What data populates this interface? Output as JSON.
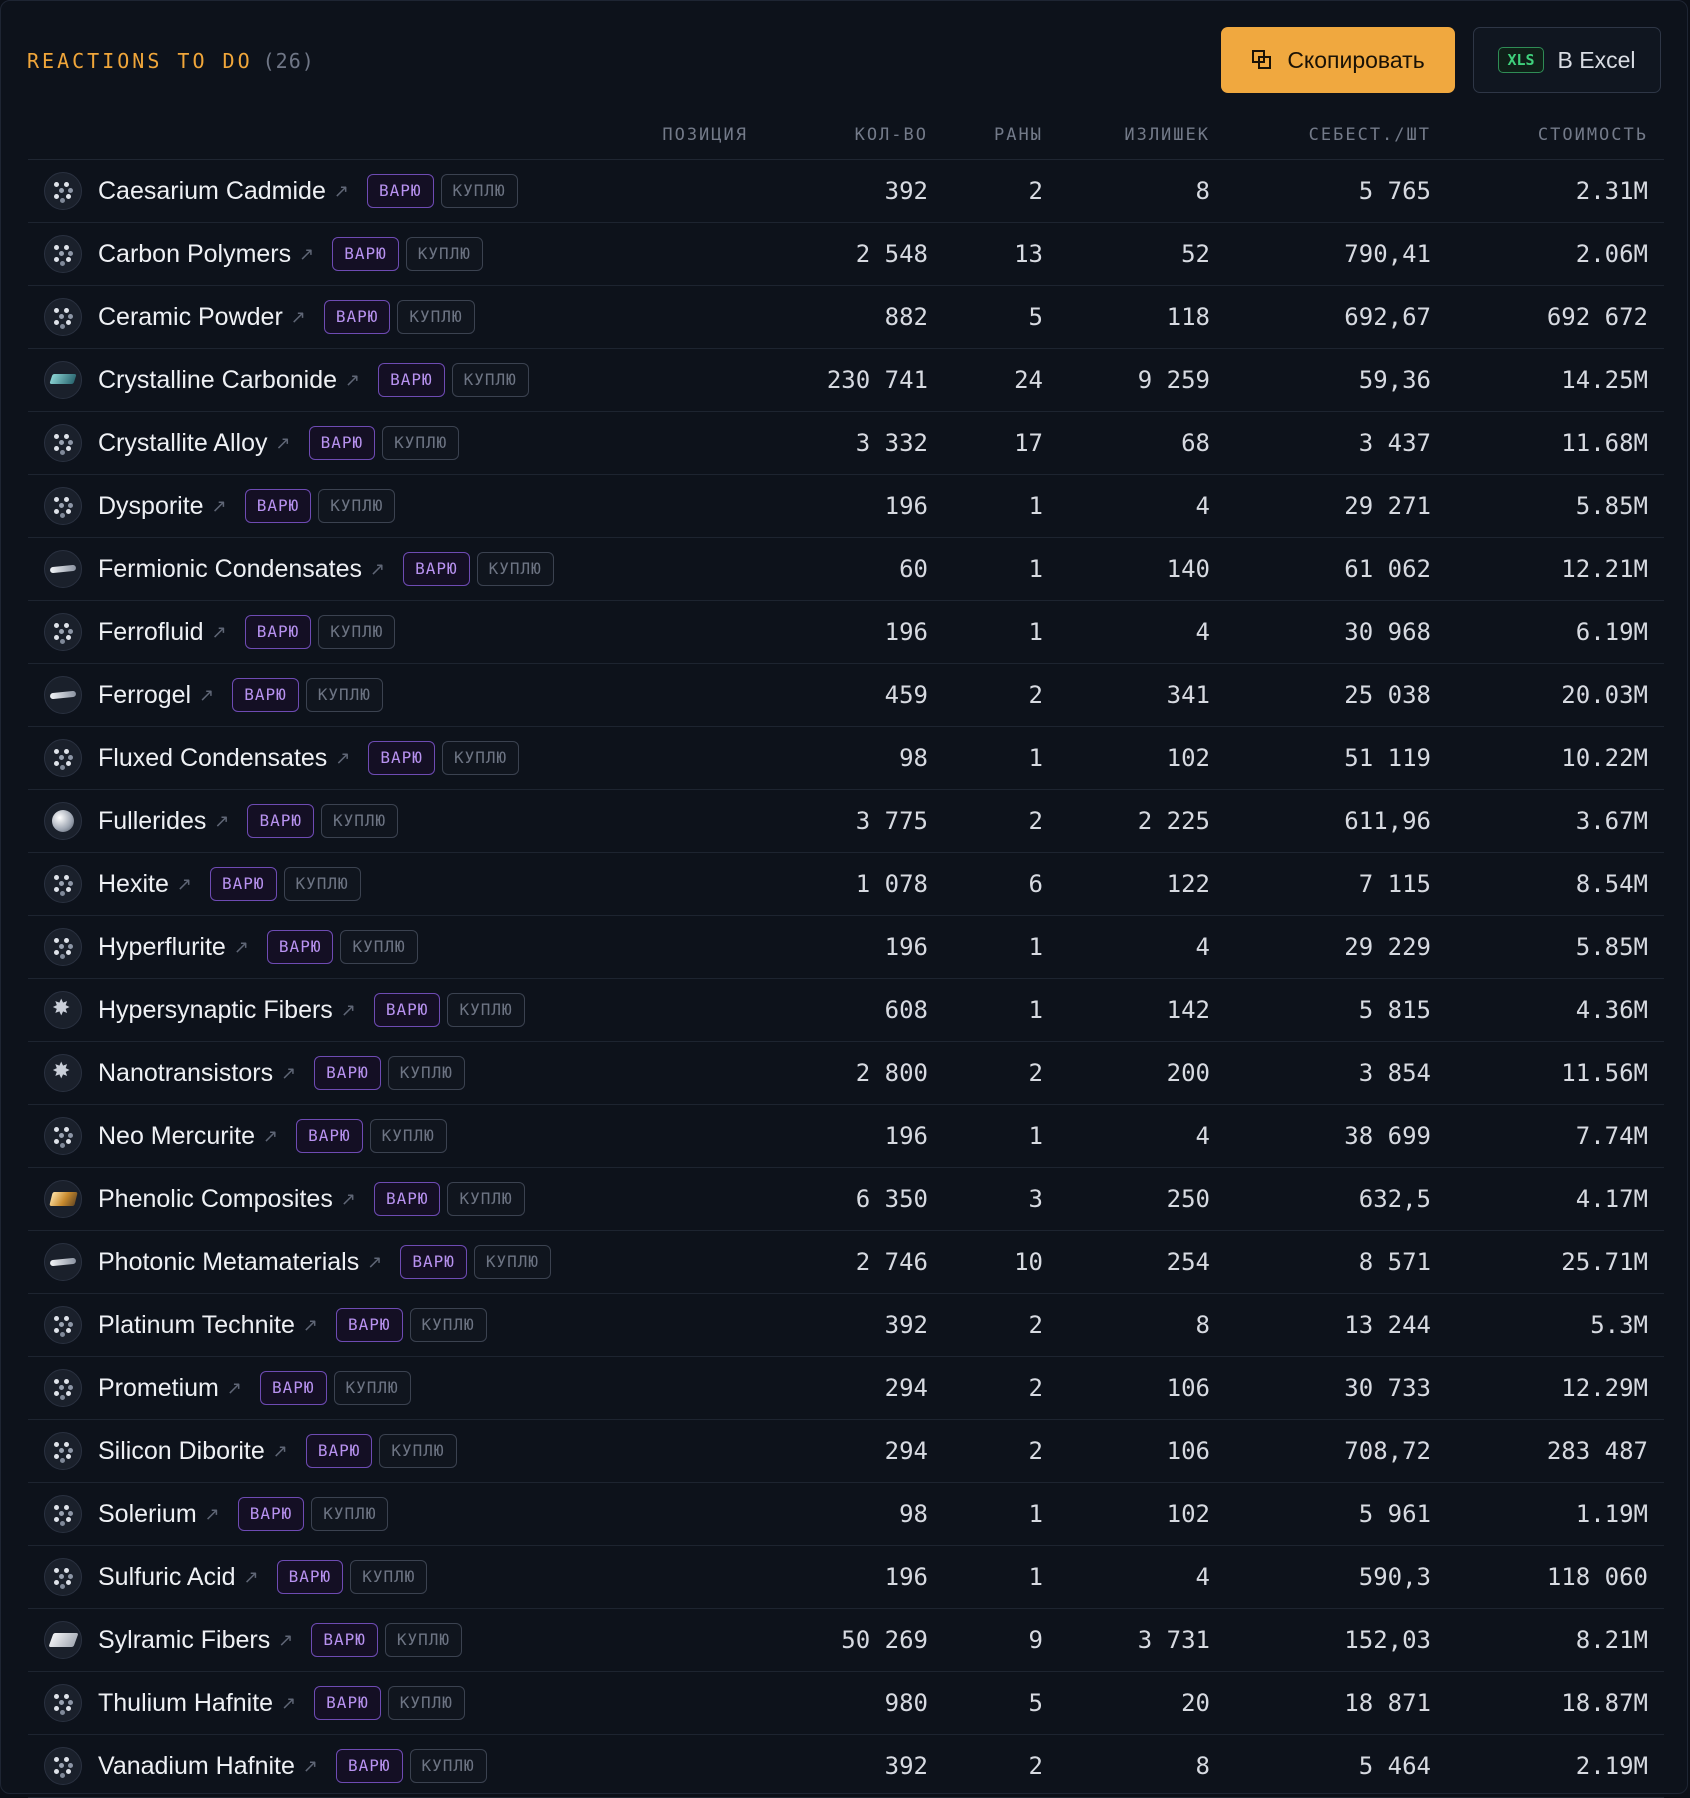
{
  "header": {
    "title": "REACTIONS TO DO",
    "count": "(26)",
    "copy_button": "Скопировать",
    "excel_badge": "XLS",
    "excel_button": "В Excel"
  },
  "columns": {
    "position": "ПОЗИЦИЯ",
    "qty": "КОЛ-ВО",
    "runs": "РАНЫ",
    "surplus": "ИЗЛИШЕК",
    "unit_cost": "СЕБЕСТ./ШТ",
    "cost": "СТОИМОСТЬ"
  },
  "tags": {
    "brew": "ВАРЮ",
    "buy": "КУПЛЮ"
  },
  "rows": [
    {
      "name": "Caesarium Cadmide",
      "icon": "molecule-icon",
      "qty": "392",
      "runs": "2",
      "surplus": "8",
      "unit_cost": "5 765",
      "cost": "2.31M"
    },
    {
      "name": "Carbon Polymers",
      "icon": "molecule-icon",
      "qty": "2 548",
      "runs": "13",
      "surplus": "52",
      "unit_cost": "790,41",
      "cost": "2.06M"
    },
    {
      "name": "Ceramic Powder",
      "icon": "molecule-icon",
      "qty": "882",
      "runs": "5",
      "surplus": "118",
      "unit_cost": "692,67",
      "cost": "692 672"
    },
    {
      "name": "Crystalline Carbonide",
      "icon": "crystal-plate-icon",
      "qty": "230 741",
      "runs": "24",
      "surplus": "9 259",
      "unit_cost": "59,36",
      "cost": "14.25M"
    },
    {
      "name": "Crystallite Alloy",
      "icon": "molecule-icon",
      "qty": "3 332",
      "runs": "17",
      "surplus": "68",
      "unit_cost": "3 437",
      "cost": "11.68M"
    },
    {
      "name": "Dysporite",
      "icon": "molecule-icon",
      "qty": "196",
      "runs": "1",
      "surplus": "4",
      "unit_cost": "29 271",
      "cost": "5.85M"
    },
    {
      "name": "Fermionic Condensates",
      "icon": "wing-icon",
      "qty": "60",
      "runs": "1",
      "surplus": "140",
      "unit_cost": "61 062",
      "cost": "12.21M"
    },
    {
      "name": "Ferrofluid",
      "icon": "molecule-icon",
      "qty": "196",
      "runs": "1",
      "surplus": "4",
      "unit_cost": "30 968",
      "cost": "6.19M"
    },
    {
      "name": "Ferrogel",
      "icon": "wing-icon",
      "qty": "459",
      "runs": "2",
      "surplus": "341",
      "unit_cost": "25 038",
      "cost": "20.03M"
    },
    {
      "name": "Fluxed Condensates",
      "icon": "molecule-icon",
      "qty": "98",
      "runs": "1",
      "surplus": "102",
      "unit_cost": "51 119",
      "cost": "10.22M"
    },
    {
      "name": "Fullerides",
      "icon": "sphere-icon",
      "qty": "3 775",
      "runs": "2",
      "surplus": "2 225",
      "unit_cost": "611,96",
      "cost": "3.67M"
    },
    {
      "name": "Hexite",
      "icon": "molecule-icon",
      "qty": "1 078",
      "runs": "6",
      "surplus": "122",
      "unit_cost": "7 115",
      "cost": "8.54M"
    },
    {
      "name": "Hyperflurite",
      "icon": "molecule-icon",
      "qty": "196",
      "runs": "1",
      "surplus": "4",
      "unit_cost": "29 229",
      "cost": "5.85M"
    },
    {
      "name": "Hypersynaptic Fibers",
      "icon": "fiber-icon",
      "qty": "608",
      "runs": "1",
      "surplus": "142",
      "unit_cost": "5 815",
      "cost": "4.36M"
    },
    {
      "name": "Nanotransistors",
      "icon": "fiber-icon",
      "qty": "2 800",
      "runs": "2",
      "surplus": "200",
      "unit_cost": "3 854",
      "cost": "11.56M"
    },
    {
      "name": "Neo Mercurite",
      "icon": "molecule-icon",
      "qty": "196",
      "runs": "1",
      "surplus": "4",
      "unit_cost": "38 699",
      "cost": "7.74M"
    },
    {
      "name": "Phenolic Composites",
      "icon": "composite-slab-icon",
      "qty": "6 350",
      "runs": "3",
      "surplus": "250",
      "unit_cost": "632,5",
      "cost": "4.17M"
    },
    {
      "name": "Photonic Metamaterials",
      "icon": "wing-icon",
      "qty": "2 746",
      "runs": "10",
      "surplus": "254",
      "unit_cost": "8 571",
      "cost": "25.71M"
    },
    {
      "name": "Platinum Technite",
      "icon": "molecule-icon",
      "qty": "392",
      "runs": "2",
      "surplus": "8",
      "unit_cost": "13 244",
      "cost": "5.3M"
    },
    {
      "name": "Prometium",
      "icon": "molecule-icon",
      "qty": "294",
      "runs": "2",
      "surplus": "106",
      "unit_cost": "30 733",
      "cost": "12.29M"
    },
    {
      "name": "Silicon Diborite",
      "icon": "molecule-icon",
      "qty": "294",
      "runs": "2",
      "surplus": "106",
      "unit_cost": "708,72",
      "cost": "283 487"
    },
    {
      "name": "Solerium",
      "icon": "molecule-icon",
      "qty": "98",
      "runs": "1",
      "surplus": "102",
      "unit_cost": "5 961",
      "cost": "1.19M"
    },
    {
      "name": "Sulfuric Acid",
      "icon": "molecule-icon",
      "qty": "196",
      "runs": "1",
      "surplus": "4",
      "unit_cost": "590,3",
      "cost": "118 060"
    },
    {
      "name": "Sylramic Fibers",
      "icon": "sheet-icon",
      "qty": "50 269",
      "runs": "9",
      "surplus": "3 731",
      "unit_cost": "152,03",
      "cost": "8.21M"
    },
    {
      "name": "Thulium Hafnite",
      "icon": "molecule-icon",
      "qty": "980",
      "runs": "5",
      "surplus": "20",
      "unit_cost": "18 871",
      "cost": "18.87M"
    },
    {
      "name": "Vanadium Hafnite",
      "icon": "molecule-icon",
      "qty": "392",
      "runs": "2",
      "surplus": "8",
      "unit_cost": "5 464",
      "cost": "2.19M"
    }
  ]
}
